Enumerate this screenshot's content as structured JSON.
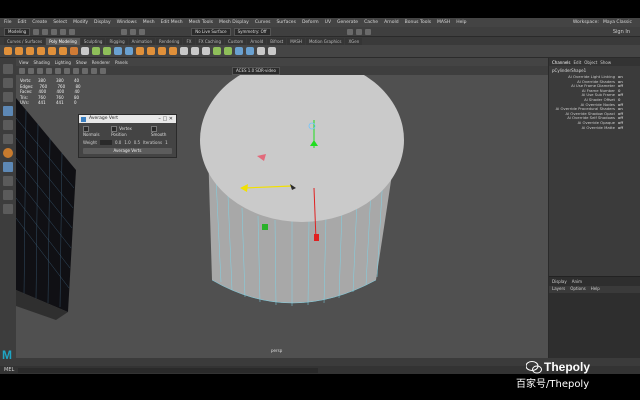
{
  "menubar": {
    "items": [
      "File",
      "Edit",
      "Create",
      "Select",
      "Modify",
      "Display",
      "Windows",
      "Mesh",
      "Edit Mesh",
      "Mesh Tools",
      "Mesh Display",
      "Curves",
      "Surfaces",
      "Deform",
      "UV",
      "Generate",
      "Cache",
      "Arnold",
      "Bonus Tools",
      "MASH",
      "Help"
    ],
    "right": [
      "Workspace:",
      "Maya Classic"
    ]
  },
  "statusline": {
    "mode": "Modeling",
    "symmetry": "No Live Surface",
    "symmetry_value": "Symmetry: Off",
    "sign_in": "Sign In"
  },
  "shelf": {
    "tabs": [
      "Curves / Surfaces",
      "Poly Modeling",
      "Sculpting",
      "Rigging",
      "Animation",
      "Rendering",
      "FX",
      "FX Caching",
      "Custom",
      "Arnold",
      "Bifrost",
      "MASH",
      "Motion Graphics",
      "XGen"
    ],
    "active_tab": "Poly Modeling"
  },
  "viewport": {
    "menu": [
      "View",
      "Shading",
      "Lighting",
      "Show",
      "Renderer",
      "Panels"
    ],
    "renderer": "ACES 1.0 SDR-video",
    "hud": [
      {
        "label": "Verts:",
        "a": "380",
        "b": "380",
        "c": "40"
      },
      {
        "label": "Edges:",
        "a": "760",
        "b": "760",
        "c": "80"
      },
      {
        "label": "Faces:",
        "a": "400",
        "b": "400",
        "c": "40"
      },
      {
        "label": "Tris:",
        "a": "760",
        "b": "760",
        "c": "80"
      },
      {
        "label": "UVs:",
        "a": "441",
        "b": "441",
        "c": "0"
      }
    ],
    "camera_label": "persp"
  },
  "dialog": {
    "title": "Average Vert",
    "options": [
      "Normals",
      "Vertex Position",
      "Smooth"
    ],
    "fields": [
      "Weight",
      "0.0",
      "1.0",
      "0.5",
      "Iterations",
      "1"
    ],
    "button": "Average Verts"
  },
  "channel_box": {
    "tabs": [
      "Channels",
      "Edit",
      "Object",
      "Show"
    ],
    "title": "pCylinderShape1",
    "attrs": [
      {
        "n": "Ai Override Light Linking",
        "v": "on"
      },
      {
        "n": "Ai Override Shaders",
        "v": "on"
      },
      {
        "n": "Ai Use Frame Diameter",
        "v": "off"
      },
      {
        "n": "Ai Frame Number",
        "v": "0"
      },
      {
        "n": "Ai Use Sub Frame",
        "v": "off"
      },
      {
        "n": "Ai Shader Offset",
        "v": "0"
      },
      {
        "n": "Ai Override Nodes",
        "v": "off"
      },
      {
        "n": "Ai Override Procedural Shaders",
        "v": "on"
      },
      {
        "n": "Ai Override Shadow Opaci",
        "v": "off"
      },
      {
        "n": "Ai Override Self Shadows",
        "v": "off"
      },
      {
        "n": "Ai Override Opaque",
        "v": "off"
      },
      {
        "n": "Ai Override Matte",
        "v": "off"
      }
    ],
    "lower_tabs": [
      "Display",
      "Anim"
    ],
    "lower_menu": [
      "Layers",
      "Options",
      "Help"
    ]
  },
  "cmdline": {
    "lang": "MEL"
  },
  "watermark": {
    "top": "Thepoly",
    "bottom": "百家号/Thepoly"
  },
  "colors": {
    "viewport_bg": "#505050",
    "ui_dark": "#3b3b3b",
    "accent": "#5d88b5",
    "wire": "#7fd3e6",
    "cylinder_top": "#cacaca",
    "cylinder_side": "#a9a9a9",
    "grid": "#5e8db5"
  }
}
